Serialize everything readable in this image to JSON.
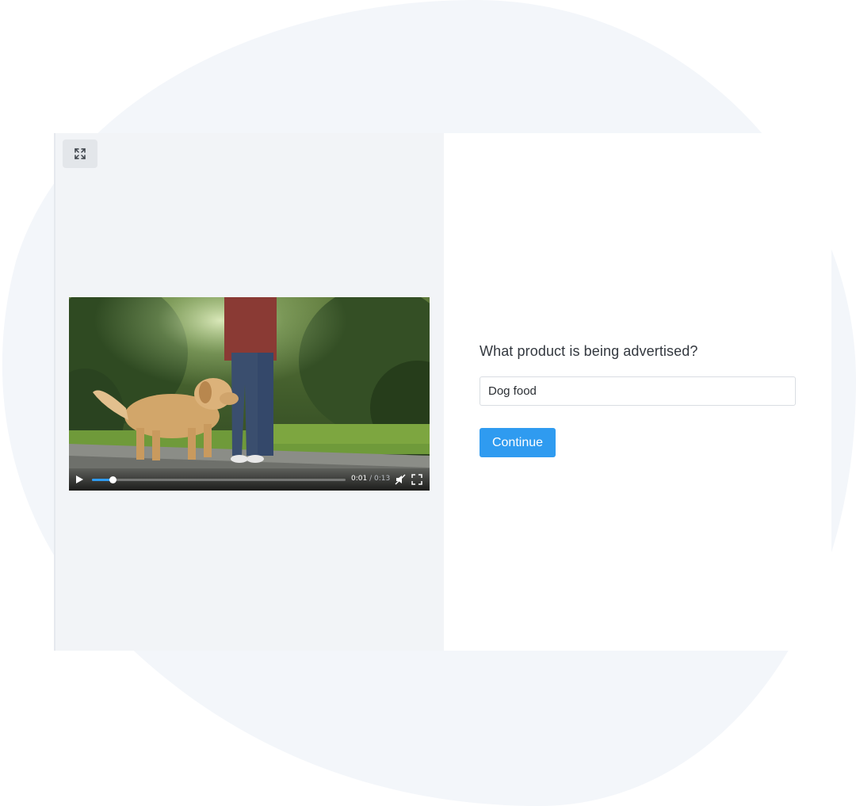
{
  "colors": {
    "accent": "#2f9bf0",
    "background_blob": "#f3f6fa",
    "media_pane": "#f2f4f7",
    "expand_button": "#e3e6ea"
  },
  "media": {
    "expand_icon": "expand-arrows-icon",
    "video": {
      "description_icon": "video-frame",
      "current_time": "0:01",
      "separator": " / ",
      "duration": "0:13",
      "progress_fraction": 0.08,
      "play_icon": "play-icon",
      "mute_icon": "muted-speaker-icon",
      "fullscreen_icon": "fullscreen-icon"
    }
  },
  "form": {
    "question": "What product is being advertised?",
    "answer_value": "Dog food",
    "continue_label": "Continue"
  }
}
